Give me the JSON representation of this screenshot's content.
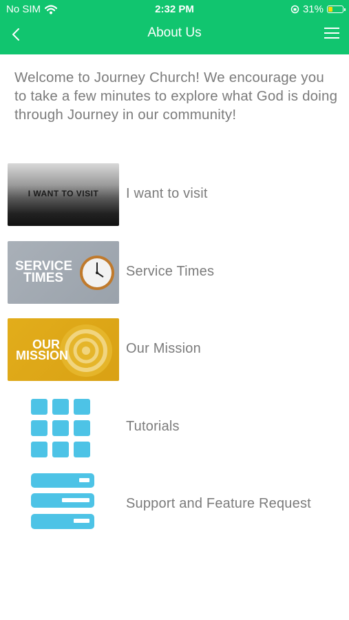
{
  "status_bar": {
    "carrier": "No SIM",
    "time": "2:32 PM",
    "battery": "31%",
    "battery_level": 0.31
  },
  "nav": {
    "title": "About Us",
    "back_icon": "chevron-left-icon",
    "menu_icon": "hamburger-menu-icon"
  },
  "intro_text": "Welcome to Journey Church! We encourage you to take a few minutes to explore what God is doing through Journey in our community!",
  "items": [
    {
      "label": "I want to visit",
      "thumb_text": "I WANT TO VISIT"
    },
    {
      "label": "Service Times",
      "thumb_text_1": "SERVICE",
      "thumb_text_2": "TIMES"
    },
    {
      "label": "Our Mission",
      "thumb_text_1": "OUR",
      "thumb_text_2": "MISSION"
    },
    {
      "label": "Tutorials",
      "icon": "grid-icon"
    },
    {
      "label": "Support and Feature Request",
      "icon": "server-icon"
    }
  ],
  "colors": {
    "header": "#11c56f",
    "text": "#7b7b7b",
    "icon_blue": "#4dc3e6"
  }
}
